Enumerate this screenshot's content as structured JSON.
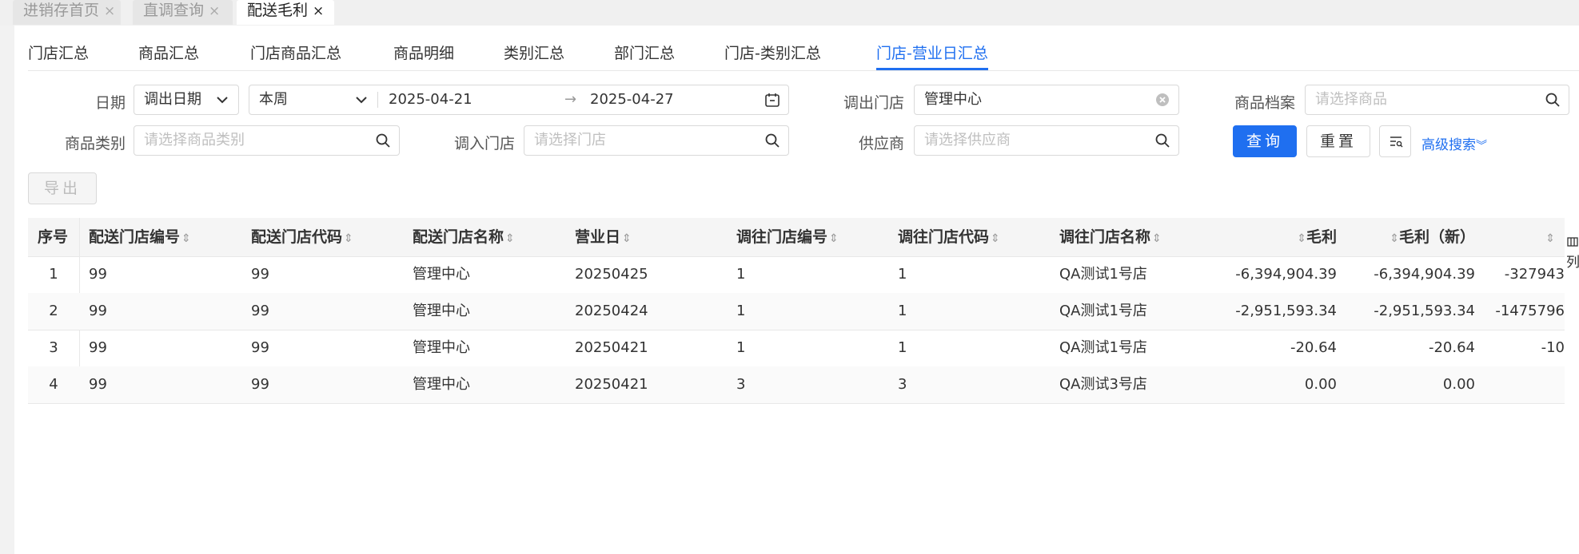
{
  "page_tabs": [
    {
      "label": "进销存首页",
      "close": "×"
    },
    {
      "label": "直调查询",
      "close": "×"
    },
    {
      "label": "配送毛利",
      "close": "×"
    }
  ],
  "subtabs": [
    "门店汇总",
    "商品汇总",
    "门店商品汇总",
    "商品明细",
    "类别汇总",
    "部门汇总",
    "门店-类别汇总",
    "门店-营业日汇总"
  ],
  "filters": {
    "date_label": "日期",
    "date_type": "调出日期",
    "period": "本周",
    "date_start": "2025-04-21",
    "date_arrow": "→",
    "date_end": "2025-04-27",
    "out_store_label": "调出门店",
    "out_store_value": "管理中心",
    "product_label": "商品档案",
    "product_placeholder": "请选择商品",
    "category_label": "商品类别",
    "category_placeholder": "请选择商品类别",
    "in_store_label": "调入门店",
    "in_store_placeholder": "请选择门店",
    "supplier_label": "供应商",
    "supplier_placeholder": "请选择供应商",
    "query_button": "查询",
    "reset_button": "重置",
    "advanced_search": "高级搜索",
    "export_button": "导出"
  },
  "table": {
    "headers": [
      "序号",
      "配送门店编号",
      "配送门店代码",
      "配送门店名称",
      "营业日",
      "调往门店编号",
      "调往门店代码",
      "调往门店名称",
      "毛利",
      "毛利（新）",
      ""
    ],
    "rows": [
      [
        "1",
        "99",
        "99",
        "管理中心",
        "20250425",
        "1",
        "1",
        "QA测试1号店",
        "-6,394,904.39",
        "-6,394,904.39",
        "-327943"
      ],
      [
        "2",
        "99",
        "99",
        "管理中心",
        "20250424",
        "1",
        "1",
        "QA测试1号店",
        "-2,951,593.34",
        "-2,951,593.34",
        "-1475796"
      ],
      [
        "3",
        "99",
        "99",
        "管理中心",
        "20250421",
        "1",
        "1",
        "QA测试1号店",
        "-20.64",
        "-20.64",
        "-10"
      ],
      [
        "4",
        "99",
        "99",
        "管理中心",
        "20250421",
        "3",
        "3",
        "QA测试3号店",
        "0.00",
        "0.00",
        ""
      ]
    ]
  },
  "side_tool_label": "列"
}
